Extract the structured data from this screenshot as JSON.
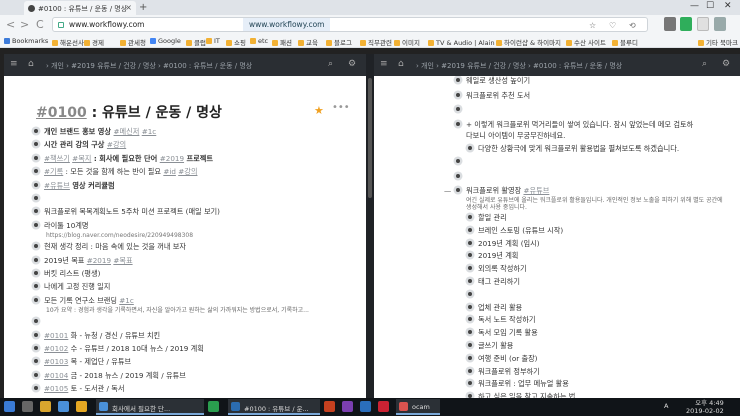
{
  "browser": {
    "tab_title": "#0100 : 유튜브 / 운동 / 명상",
    "tab_close": "×",
    "new_tab": "+",
    "window_buttons": [
      "—",
      "☐",
      "✕"
    ],
    "nav_back": "<",
    "nav_forward": ">",
    "nav_reload": "C",
    "url_host": "www.workflowy.com",
    "url_duplicate": "www.workflowy.com",
    "bookmarks": [
      {
        "label": "Bookmarks",
        "color": "#3d7bd9"
      },
      {
        "label": "해운선사",
        "color": "#f2b134"
      },
      {
        "label": "경제",
        "color": "#f2b134"
      },
      {
        "label": "관세청",
        "color": "#f2b134"
      },
      {
        "label": "Google",
        "color": "#4285f4"
      },
      {
        "label": "클럽",
        "color": "#f2b134"
      },
      {
        "label": "IT",
        "color": "#f2b134"
      },
      {
        "label": "쇼핑",
        "color": "#f2b134"
      },
      {
        "label": "etc",
        "color": "#f2b134"
      },
      {
        "label": "패션",
        "color": "#f2b134"
      },
      {
        "label": "교육",
        "color": "#f2b134"
      },
      {
        "label": "블로그",
        "color": "#f2b134"
      },
      {
        "label": "직무관련",
        "color": "#f2b134"
      },
      {
        "label": "이미지",
        "color": "#f2b134"
      },
      {
        "label": "TV & Audio | Alain 소",
        "color": "#f2b134"
      },
      {
        "label": "하이런샵 & 하이마지",
        "color": "#f2b134"
      },
      {
        "label": "수산 사이트",
        "color": "#f2b134"
      },
      {
        "label": "블루디",
        "color": "#f2b134"
      },
      {
        "label": "기타 북마크",
        "color": "#f2b134"
      }
    ]
  },
  "left_pane": {
    "breadcrumb": [
      "개인",
      "#2019 유튜브 / 건강 / 명상",
      "#0100 : 유튜브 / 운동 / 명상"
    ],
    "title_hash": "#0100",
    "title_rest": " : 유튜브 / 운동 / 명상",
    "star": "★",
    "more": "•••",
    "items": [
      {
        "parts": [
          {
            "t": "개인 브랜드 홍보 영상 ",
            "c": "bold"
          },
          {
            "t": "#메신저",
            "c": "tag"
          },
          {
            "t": " "
          },
          {
            "t": "#1c",
            "c": "tag"
          }
        ]
      },
      {
        "parts": [
          {
            "t": "시간 관리 강의 구상 ",
            "c": "bold"
          },
          {
            "t": "#강의",
            "c": "tag"
          }
        ]
      },
      {
        "parts": [
          {
            "t": "#책쓰기",
            "c": "tag"
          },
          {
            "t": " "
          },
          {
            "t": "#목지",
            "c": "tag"
          },
          {
            "t": " : 회사에 필요한 단어 ",
            "c": "bold"
          },
          {
            "t": "#2019",
            "c": "tag"
          },
          {
            "t": " 프로젝트",
            "c": "bold"
          }
        ]
      },
      {
        "parts": [
          {
            "t": "#기록",
            "c": "tag"
          },
          {
            "t": " : 모든 것을 함께 하는 반이 필요 "
          },
          {
            "t": "#id",
            "c": "tag"
          },
          {
            "t": " "
          },
          {
            "t": "#강의",
            "c": "tag"
          }
        ]
      },
      {
        "parts": [
          {
            "t": "#유튜브",
            "c": "tag"
          },
          {
            "t": " 영상 커리큘럼",
            "c": "bold"
          }
        ]
      },
      {
        "parts": []
      },
      {
        "parts": [
          {
            "t": "워크플로위 목목계획노트 5주차 미션 프로젝트 (매일 보기)"
          }
        ]
      },
      {
        "parts": [
          {
            "t": "라이툴 10계명"
          }
        ],
        "link": "https://blog.naver.com/neodesire/220949498308"
      },
      {
        "parts": [
          {
            "t": "현재 생각 정리 : 마음 속에 있는 것을 꺼내 보자"
          }
        ]
      },
      {
        "parts": [
          {
            "t": "2019년 목표 "
          },
          {
            "t": "#2019",
            "c": "tag"
          },
          {
            "t": " "
          },
          {
            "t": "#목표",
            "c": "tag"
          }
        ]
      },
      {
        "parts": [
          {
            "t": "버킷 리스트 (평생)"
          }
        ]
      },
      {
        "parts": [
          {
            "t": "나에게 고정 진행 일지"
          }
        ]
      },
      {
        "parts": [
          {
            "t": "모든 기록 연구소 브랜딩 "
          },
          {
            "t": "#1c",
            "c": "tag"
          }
        ],
        "note": "10가 요약 : 경험과 생각을 기록하면서, 자신을 알아가고 원하는 삶의 가까워지는 방법으로서, 기록하고..."
      },
      {
        "parts": []
      },
      {
        "parts": [
          {
            "t": "#0101",
            "c": "tag"
          },
          {
            "t": " 화 - 뉴청 / 경신 / 유튜브 치킨"
          }
        ]
      },
      {
        "parts": [
          {
            "t": "#0102",
            "c": "tag"
          },
          {
            "t": " 수 - 유튜브 / 2018 10대 뉴스 / 2019 계획"
          }
        ]
      },
      {
        "parts": [
          {
            "t": "#0103",
            "c": "tag"
          },
          {
            "t": " 목 - 제업단 / 유튜브"
          }
        ]
      },
      {
        "parts": [
          {
            "t": "#0104",
            "c": "tag"
          },
          {
            "t": " 금 - 2018 뉴스 / 2019 계획 / 유튜브"
          }
        ]
      },
      {
        "parts": [
          {
            "t": "#0105",
            "c": "tag"
          },
          {
            "t": " 토 - 도서관 / 독서"
          }
        ]
      }
    ]
  },
  "right_pane": {
    "breadcrumb": [
      "개인",
      "#2019 유튜브 / 건강 / 명상",
      "#0100 : 유튜브 / 운동 / 명상"
    ],
    "items": [
      {
        "indent": 0,
        "text": "웨일로 생산성 높이기"
      },
      {
        "indent": 0,
        "text": "워크플로위 추천 도서"
      },
      {
        "indent": 0,
        "text": ""
      },
      {
        "indent": 0,
        "text": "+ 이렇게 워크플로위 먹거리들이 쌓여 있습니다. 잠시 앞었는데 메모 검토하"
      },
      {
        "indent": 0,
        "text": "다보니 아이템이 무궁무진하네요.",
        "cont": true
      },
      {
        "indent": 1,
        "text": "다양한 상황극에 맞게 워크플로위 활용법을 펼쳐보도록 하겠습니다."
      },
      {
        "indent": 0,
        "text": ""
      },
      {
        "indent": 0,
        "text": ""
      },
      {
        "indent": 0,
        "text": "워크플로위 활영장 ",
        "tag": "#유튜브",
        "collapse": "—",
        "note": "여긴 실제로 유튜브에 올리는 워크플로위 활용들입니다. 개인적인 정보 노출을 피하기 위해 별도 공간에 생성해서 사용 중입니다."
      },
      {
        "indent": 1,
        "text": "할일 관리"
      },
      {
        "indent": 1,
        "text": "브레인 스토밍 (유튜브 시작)"
      },
      {
        "indent": 1,
        "text": "2019년 계획 (임시)"
      },
      {
        "indent": 1,
        "text": "2019년 계획"
      },
      {
        "indent": 1,
        "text": "외의록 작성하기"
      },
      {
        "indent": 1,
        "text": "태그 관리하기"
      },
      {
        "indent": 1,
        "text": ""
      },
      {
        "indent": 1,
        "text": "업체 관리 활용"
      },
      {
        "indent": 1,
        "text": "독서 노트 작성하기"
      },
      {
        "indent": 1,
        "text": "독서 모임 기록 활용"
      },
      {
        "indent": 1,
        "text": "글쓰기 활용"
      },
      {
        "indent": 1,
        "text": "여행 준비 (or 출장)"
      },
      {
        "indent": 1,
        "text": "워크플로위 정부하기"
      },
      {
        "indent": 1,
        "text": "워크플로위 : 업무 메뉴얼 활용"
      },
      {
        "indent": 1,
        "text": "하고 싶은 일을 찾고 지속하는 법"
      }
    ]
  },
  "taskbar": {
    "apps": [
      {
        "label": "회사에서 필요한 단...",
        "color": "#4a90d9"
      },
      {
        "label": "#0100 : 유튜브 / 운...",
        "color": "#2b6cb0"
      },
      {
        "label": "ocam",
        "color": "#d9534f"
      }
    ],
    "clock_time": "오후 4:49",
    "clock_date": "2019-02-02",
    "lang": "A"
  }
}
